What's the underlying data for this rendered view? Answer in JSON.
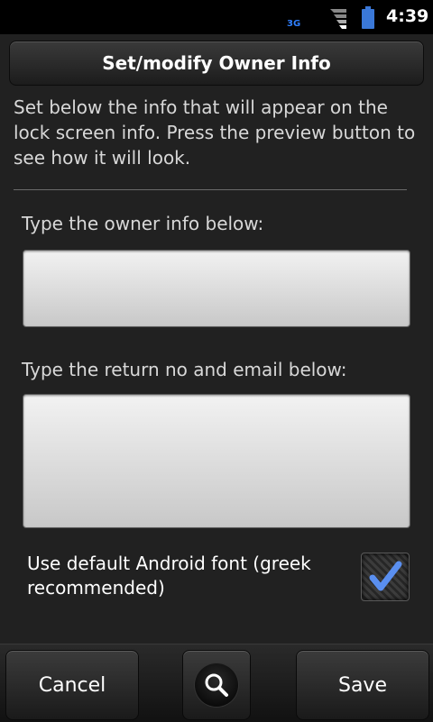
{
  "status_bar": {
    "network": "3G",
    "time": "4:39",
    "icons": [
      "signal-icon",
      "battery-icon"
    ]
  },
  "dialog": {
    "title": "Set/modify Owner Info",
    "intro": "Set below the info that will appear on the lock screen info. Press the preview button to see how it will look.",
    "owner_label": "Type the owner info below:",
    "owner_value": "",
    "return_label": "Type the return no and email below:",
    "return_value": "",
    "checkbox_label": "Use default Android font (greek recommended)",
    "checkbox_checked": true
  },
  "bottom_bar": {
    "cancel_label": "Cancel",
    "preview_icon": "search-icon",
    "save_label": "Save"
  },
  "colors": {
    "accent": "#2f7fff",
    "check": "#5a8ff0"
  }
}
